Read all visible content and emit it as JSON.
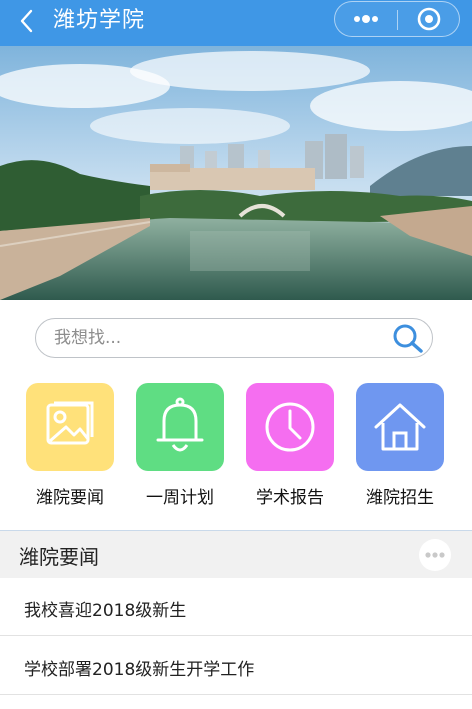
{
  "header": {
    "title": "潍坊学院",
    "back_icon": "back-arrow-icon",
    "more_icon": "more-dots-icon",
    "close_icon": "target-close-icon",
    "color": "#3f97e6"
  },
  "banner": {
    "alt": "campus-lake-photo"
  },
  "search": {
    "placeholder": "我想找...",
    "icon": "search-icon"
  },
  "menu": [
    {
      "label": "潍院要闻",
      "icon": "picture-icon",
      "color": "#ffe17a"
    },
    {
      "label": "一周计划",
      "icon": "bell-icon",
      "color": "#5fdd83"
    },
    {
      "label": "学术报告",
      "icon": "clock-icon",
      "color": "#f56ef0"
    },
    {
      "label": "潍院招生",
      "icon": "home-icon",
      "color": "#6f97f0"
    }
  ],
  "news_section": {
    "title": "潍院要闻",
    "more_icon": "more-dots-icon",
    "items": [
      {
        "title": "我校喜迎2018级新生"
      },
      {
        "title": "学校部署2018级新生开学工作"
      }
    ]
  }
}
